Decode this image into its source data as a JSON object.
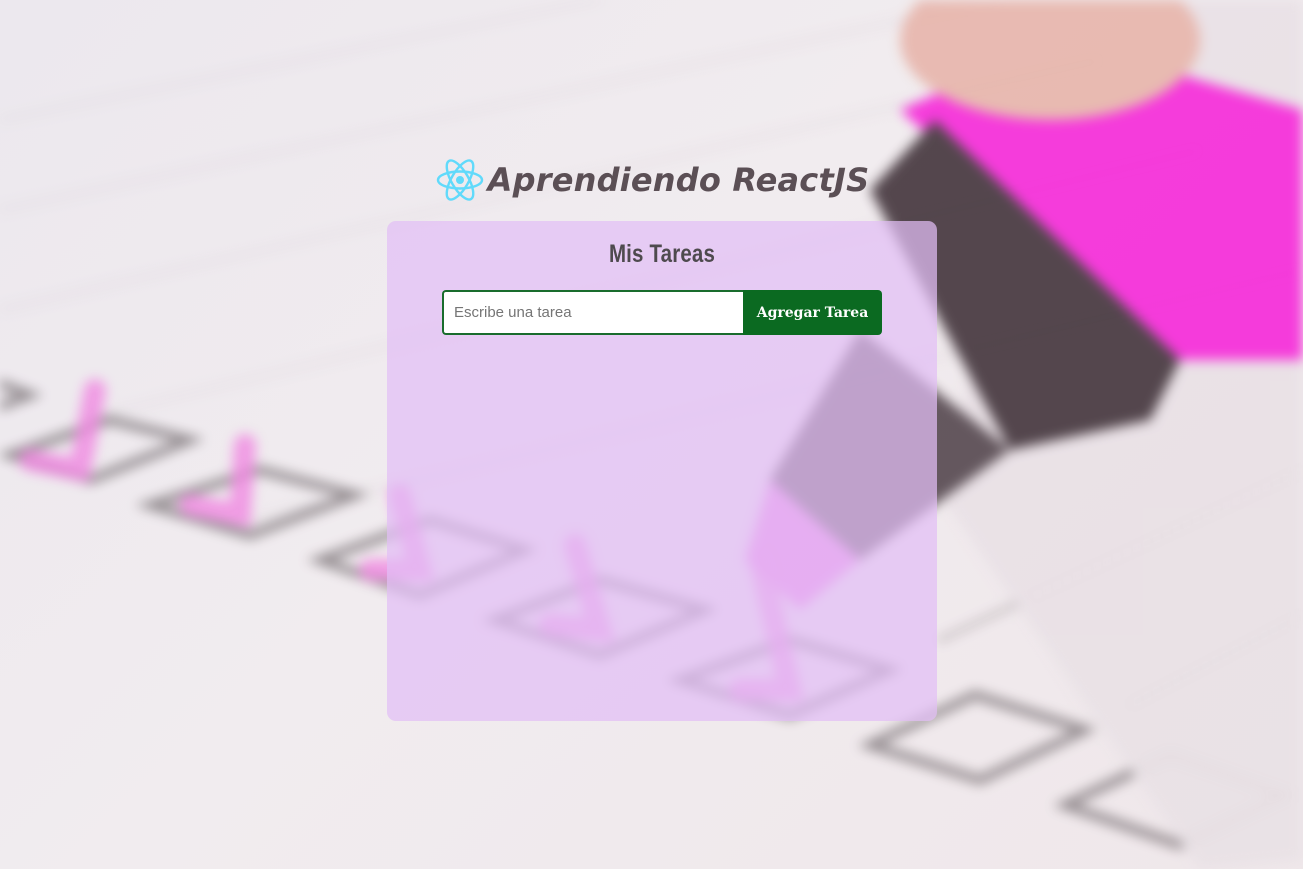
{
  "header": {
    "title": "Aprendiendo ReactJS",
    "logo_icon": "react-atom-icon",
    "logo_color": "#61dafb"
  },
  "card": {
    "title": "Mis Tareas",
    "background": "#e2bef5"
  },
  "form": {
    "input_placeholder": "Escribe una tarea",
    "input_value": "",
    "button_label": "Agregar Tarea",
    "button_color": "#0b6a21"
  }
}
